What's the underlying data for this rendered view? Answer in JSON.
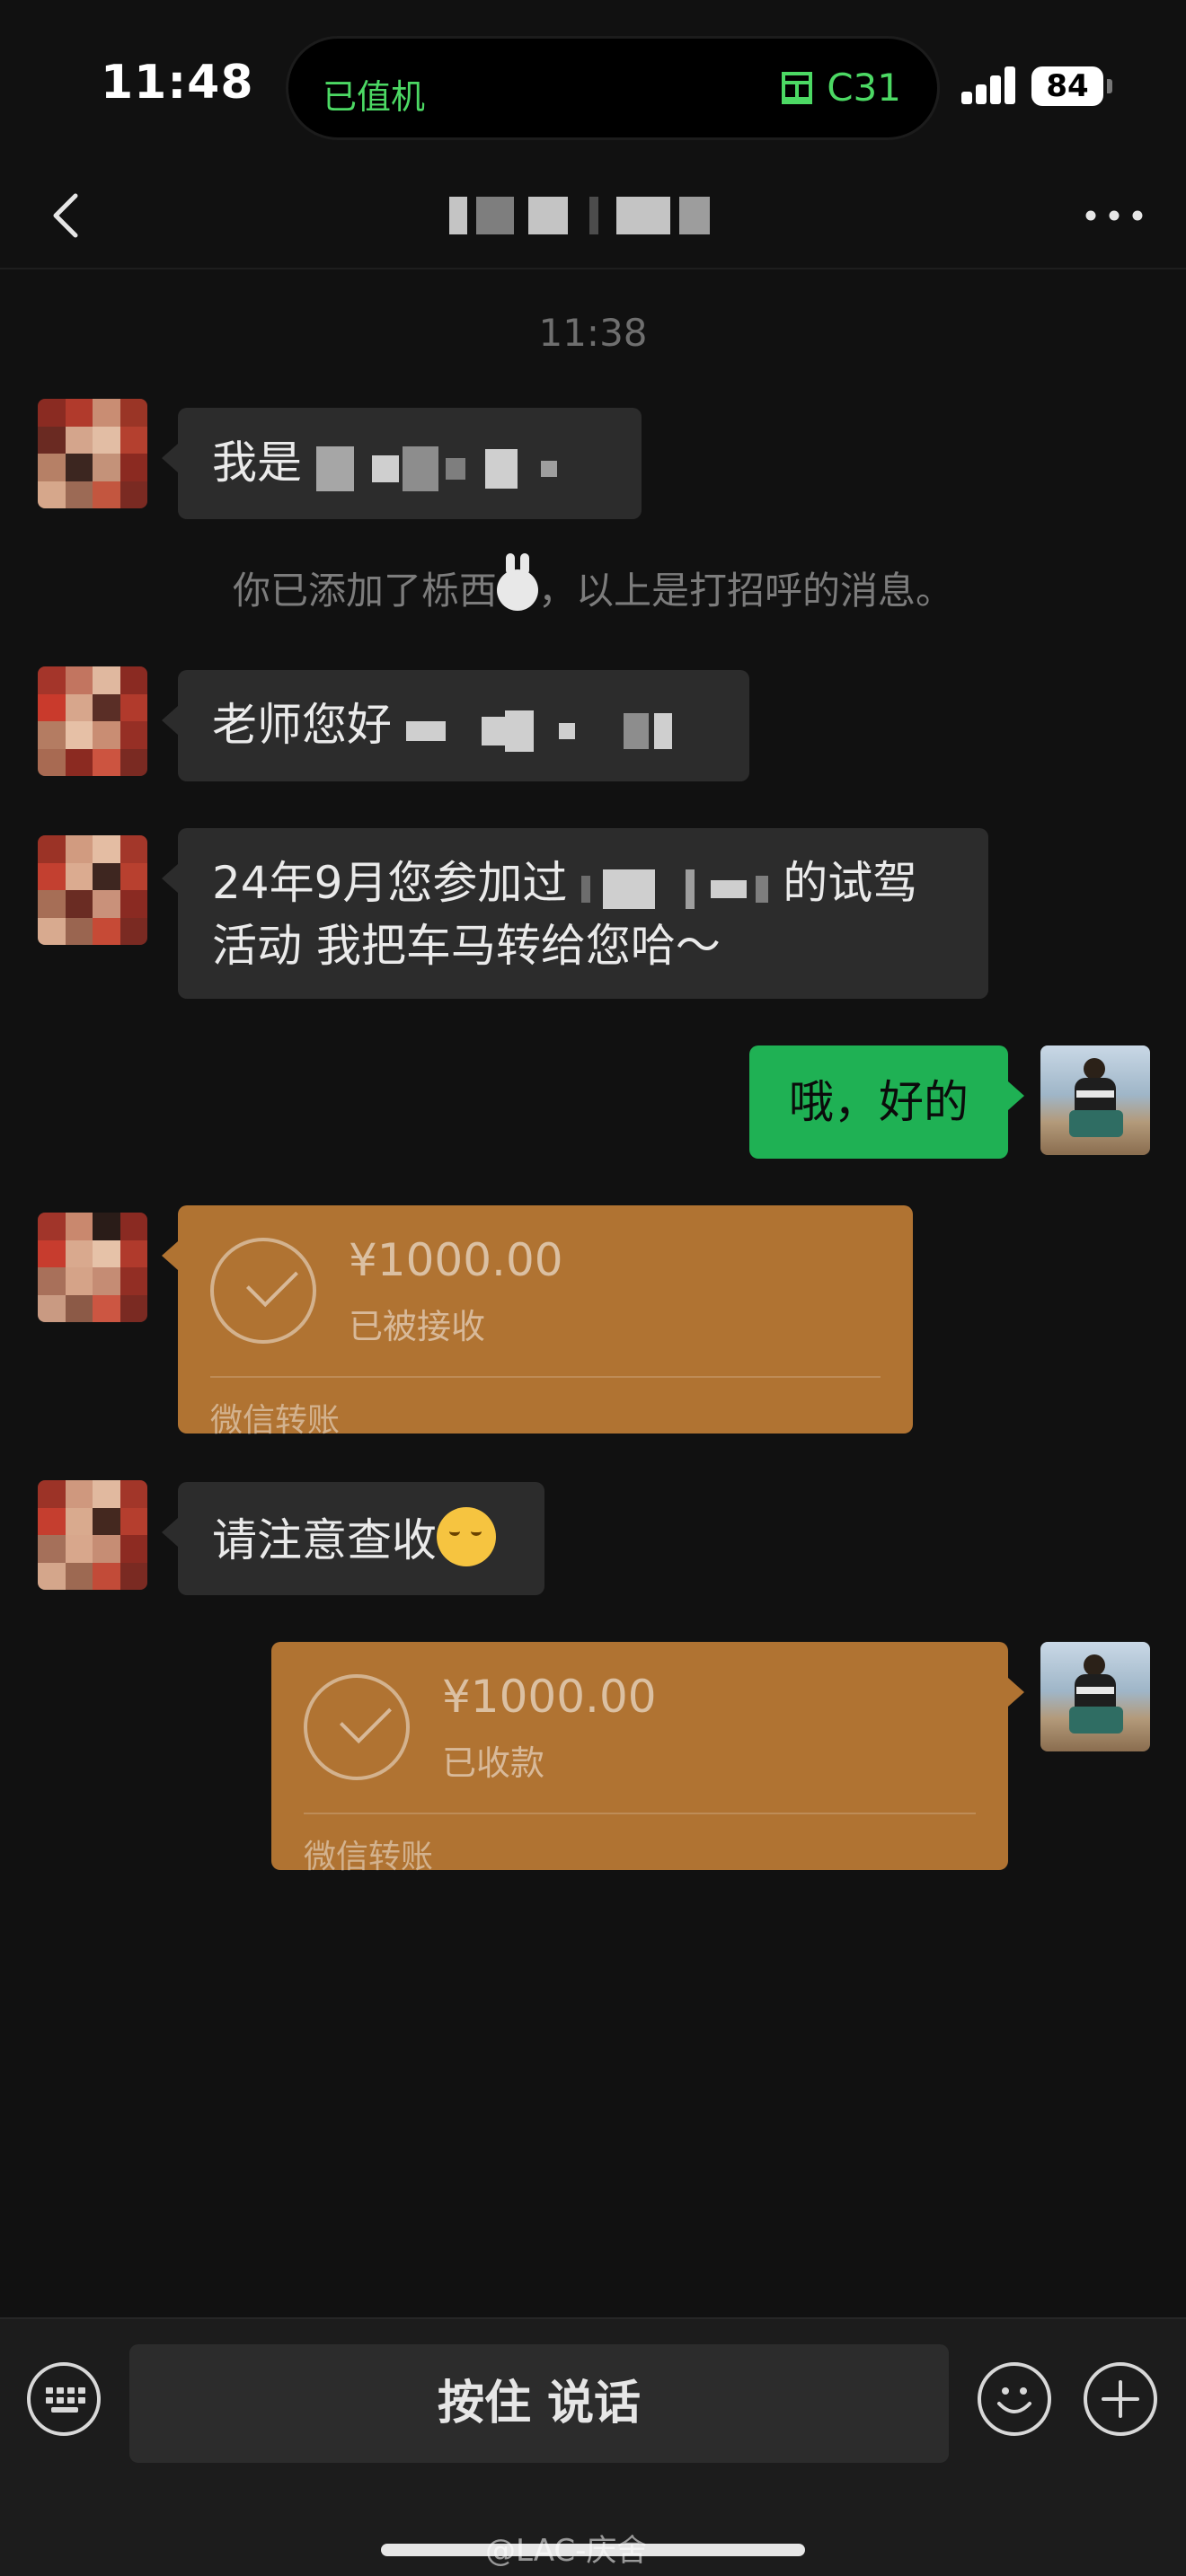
{
  "status_bar": {
    "time": "11:48",
    "island_left": "已值机",
    "island_right": "C31",
    "battery": "84"
  },
  "nav": {
    "back_icon": "chevron-left-icon",
    "more_icon": "ellipsis-icon"
  },
  "chat": {
    "timestamp": "11:38",
    "messages": [
      {
        "from": "other",
        "prefix": "我是",
        "suffix": ""
      },
      {
        "from": "system",
        "text_before": "你已添加了栎西",
        "text_after": "，以上是打招呼的消息。"
      },
      {
        "from": "other",
        "prefix": "老师您好",
        "suffix": ""
      },
      {
        "from": "other",
        "line1_prefix": "24年9月您参加过",
        "line1_suffix": "的试驾",
        "line2": "活动 我把车马转给您哈～"
      },
      {
        "from": "me",
        "text": "哦，好的"
      },
      {
        "from": "other",
        "type": "transfer",
        "amount": "¥1000.00",
        "status": "已被接收",
        "label": "微信转账"
      },
      {
        "from": "other",
        "text": "请注意查收"
      },
      {
        "from": "me",
        "type": "transfer",
        "amount": "¥1000.00",
        "status": "已收款",
        "label": "微信转账"
      }
    ]
  },
  "input_bar": {
    "hold_to_talk": "按住 说话",
    "keyboard_icon": "keyboard-icon",
    "emoji_icon": "emoji-icon",
    "plus_icon": "plus-icon"
  },
  "watermark": "@LAC-庆舍",
  "colors": {
    "background": "#111111",
    "bubble_other": "#2c2c2c",
    "bubble_me": "#1fb154",
    "transfer": "#b07332",
    "island_text": "#4cd964"
  }
}
